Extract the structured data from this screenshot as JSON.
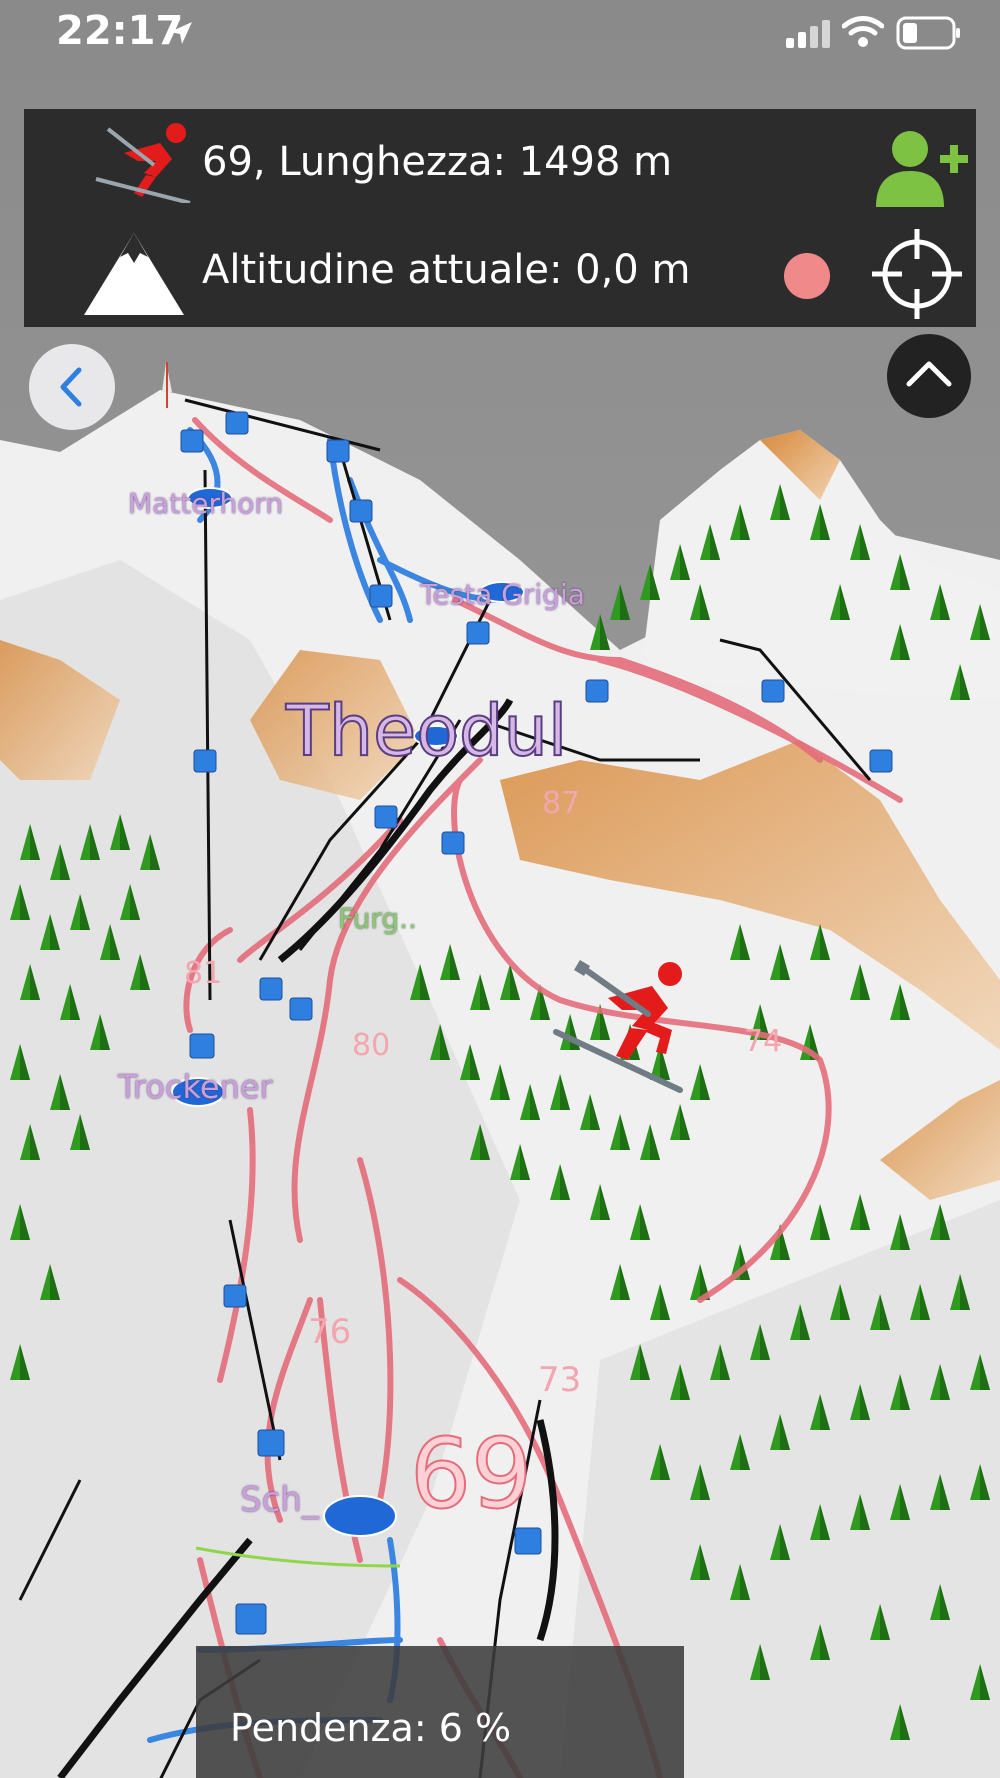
{
  "status_bar": {
    "time": "22:17"
  },
  "info_panel": {
    "run_info": "69, Lunghezza: 1498 m",
    "altitude": "Altitudine attuale: 0,0 m"
  },
  "map": {
    "area_label": "Theodul",
    "station_labels": [
      "Matterhorn",
      "Testa Grigia",
      "Furg..",
      "Trockener",
      "Sch_"
    ],
    "run_numbers": [
      "87",
      "81",
      "80",
      "74",
      "76",
      "73"
    ],
    "selected_run": "69"
  },
  "bottom_bar": {
    "slope": "Pendenza: 6 %"
  },
  "colors": {
    "accent_green": "#7dc242",
    "skier_red": "#e31b1b",
    "run_pink": "#e46d7a",
    "lift_blue": "#2f7fe0",
    "panel_dark": "#2c2c2c",
    "record_dot": "#f08a8a"
  }
}
